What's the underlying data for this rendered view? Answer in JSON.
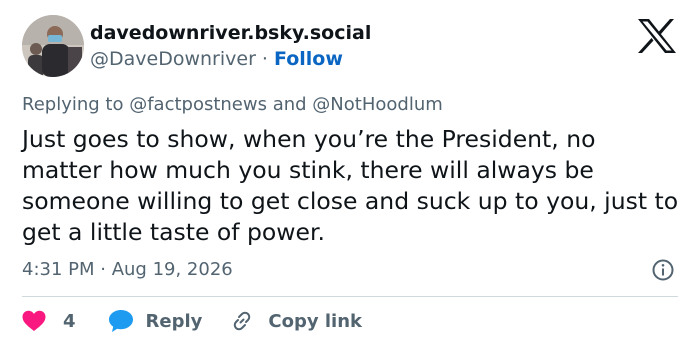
{
  "author": {
    "display_name": "davedownriver.bsky.social",
    "handle": "@DaveDownriver",
    "separator": " · ",
    "follow_label": "Follow"
  },
  "brand": {
    "logo_icon": "x-logo-icon"
  },
  "reply_context": {
    "prefix": "Replying to ",
    "mention_1": "@factpostnews",
    "joiner": " and ",
    "mention_2": "@NotHoodlum"
  },
  "tweet": {
    "text": "Just goes to show, when you’re the President, no matter how much you stink, there will always be someone willing to get close and suck up to you, just to get a little taste of power."
  },
  "meta": {
    "time": "4:31 PM",
    "separator": " · ",
    "date": "Aug 19, 2026",
    "info_icon": "info-icon"
  },
  "actions": {
    "like_count": "4",
    "reply_label": "Reply",
    "copy_link_label": "Copy link"
  },
  "colors": {
    "text_primary": "#0f1419",
    "text_secondary": "#536471",
    "link_blue": "#0a66c2",
    "like_pink": "#f91880",
    "reply_blue": "#1d9bf0",
    "divider": "#cfd9de"
  }
}
